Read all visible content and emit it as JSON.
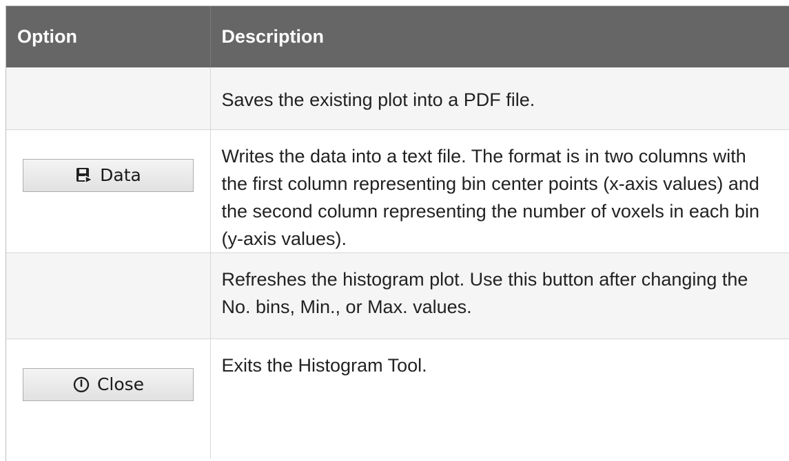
{
  "header": {
    "option": "Option",
    "description": "Description"
  },
  "rows": [
    {
      "button": null,
      "description": "Saves the existing plot into a PDF file."
    },
    {
      "button": {
        "label": "Data",
        "icon": "save-data-icon"
      },
      "description": "Writes the data into a text file. The format is in two columns with the first column representing bin center points (x-axis values) and the second column representing the number of voxels in each bin (y-axis values)."
    },
    {
      "button": null,
      "description": "Refreshes the histogram plot. Use this button after changing the No. bins, Min., or Max. values."
    },
    {
      "button": {
        "label": "Close",
        "icon": "power-icon"
      },
      "description": "Exits the Histogram Tool."
    }
  ],
  "colors": {
    "header_bg": "#666666",
    "header_text": "#ffffff",
    "stripe_bg": "#f5f5f5",
    "body_text": "#222222"
  }
}
